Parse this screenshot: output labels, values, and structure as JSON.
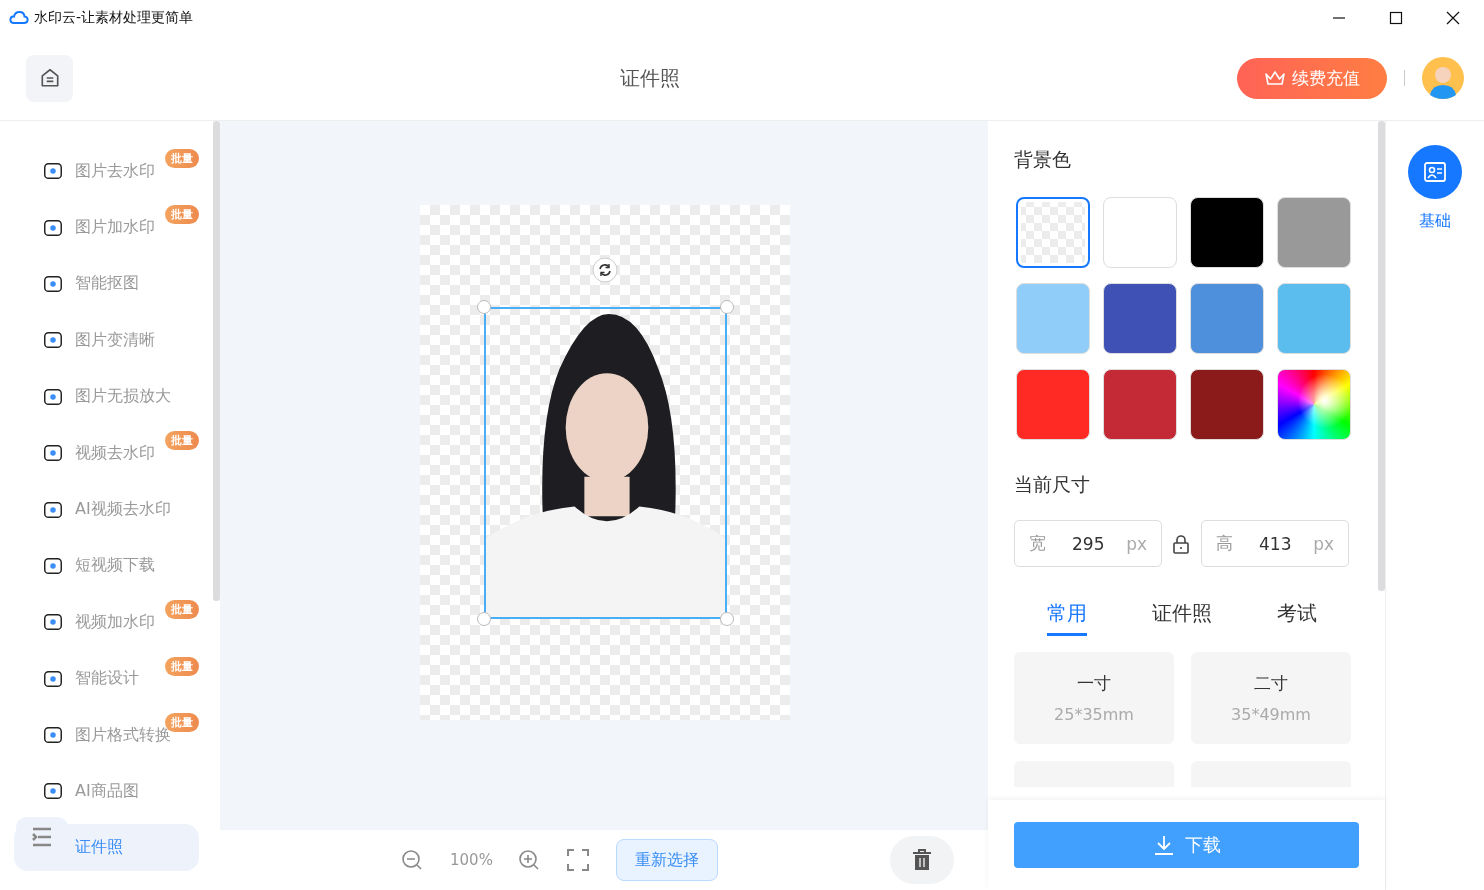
{
  "window": {
    "title": "水印云-让素材处理更简单"
  },
  "header": {
    "title": "证件照",
    "renew_button": "续费充值"
  },
  "sidebar": {
    "items": [
      {
        "label": "图片去水印",
        "badge": "批量",
        "selected": false
      },
      {
        "label": "图片加水印",
        "badge": "批量",
        "selected": false
      },
      {
        "label": "智能抠图",
        "selected": false
      },
      {
        "label": "图片变清晰",
        "selected": false
      },
      {
        "label": "图片无损放大",
        "selected": false
      },
      {
        "label": "视频去水印",
        "badge": "批量",
        "selected": false
      },
      {
        "label": "AI视频去水印",
        "selected": false
      },
      {
        "label": "短视频下载",
        "selected": false
      },
      {
        "label": "视频加水印",
        "badge": "批量",
        "selected": false
      },
      {
        "label": "智能设计",
        "badge": "批量",
        "selected": false
      },
      {
        "label": "图片格式转换",
        "badge": "批量",
        "selected": false
      },
      {
        "label": "AI商品图",
        "selected": false
      },
      {
        "label": "证件照",
        "selected": true
      }
    ]
  },
  "canvas": {
    "zoom": "100%",
    "reselect_button": "重新选择"
  },
  "background_color": {
    "title": "背景色",
    "swatches": [
      {
        "kind": "transparent",
        "selected": true
      },
      {
        "kind": "solid",
        "color": "#ffffff",
        "selected": false
      },
      {
        "kind": "solid",
        "color": "#000000",
        "selected": false
      },
      {
        "kind": "solid",
        "color": "#999999",
        "selected": false
      },
      {
        "kind": "solid",
        "color": "#90cdf8",
        "selected": false
      },
      {
        "kind": "solid",
        "color": "#3f51b5",
        "selected": false
      },
      {
        "kind": "solid",
        "color": "#4f90dc",
        "selected": false
      },
      {
        "kind": "solid",
        "color": "#5bbcee",
        "selected": false
      },
      {
        "kind": "solid",
        "color": "#ff2a24",
        "selected": false
      },
      {
        "kind": "solid",
        "color": "#c42a36",
        "selected": false
      },
      {
        "kind": "solid",
        "color": "#8b1a1a",
        "selected": false
      },
      {
        "kind": "spectrum",
        "selected": false
      }
    ]
  },
  "size": {
    "title": "当前尺寸",
    "width": {
      "label": "宽",
      "value": "295",
      "unit": "px"
    },
    "height": {
      "label": "高",
      "value": "413",
      "unit": "px"
    }
  },
  "preset_tabs": [
    {
      "label": "常用",
      "selected": true
    },
    {
      "label": "证件照",
      "selected": false
    },
    {
      "label": "考试",
      "selected": false
    }
  ],
  "presets": [
    {
      "name": "一寸",
      "dims": "25*35mm"
    },
    {
      "name": "二寸",
      "dims": "35*49mm"
    }
  ],
  "download_button": "下载",
  "right_rail": {
    "items": [
      {
        "label": "基础",
        "selected": true
      }
    ]
  }
}
